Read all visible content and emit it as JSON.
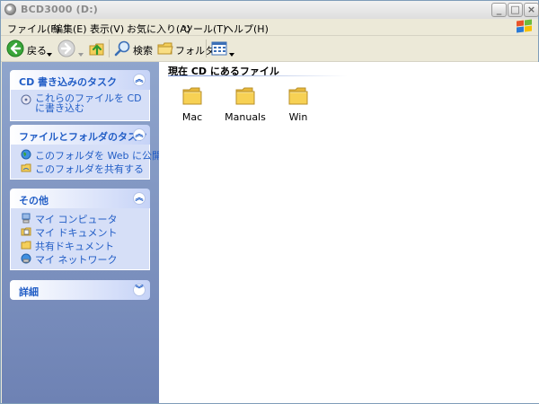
{
  "window": {
    "title": "BCD3000 (D:)",
    "minimize_glyph": "_",
    "maximize_glyph": "□",
    "close_glyph": "×"
  },
  "menu": [
    "ファイル(F)",
    "編集(E)",
    "表示(V)",
    "お気に入り(A)",
    "ツール(T)",
    "ヘルプ(H)"
  ],
  "toolbar": {
    "back_label": "戻る",
    "search_label": "検索",
    "folders_label": "フォルダ"
  },
  "left_pane": {
    "cd_tasks": {
      "title": "CD 書き込みのタスク",
      "items": [
        {
          "label": "これらのファイルを CD に書き込む",
          "icon": "cd-burn-icon"
        }
      ]
    },
    "folder_tasks": {
      "title": "ファイルとフォルダのタスク",
      "items": [
        {
          "label": "このフォルダを Web に公開する",
          "icon": "globe-icon"
        },
        {
          "label": "このフォルダを共有する",
          "icon": "share-folder-icon"
        }
      ]
    },
    "other": {
      "title": "その他",
      "items": [
        {
          "label": "マイ コンピュータ",
          "icon": "my-computer-icon"
        },
        {
          "label": "マイ ドキュメント",
          "icon": "my-documents-icon"
        },
        {
          "label": "共有ドキュメント",
          "icon": "shared-documents-icon"
        },
        {
          "label": "マイ ネットワーク",
          "icon": "my-network-icon"
        }
      ]
    },
    "details": {
      "title": "詳細"
    }
  },
  "main": {
    "heading": "現在 CD にあるファイル",
    "folders": [
      "Mac",
      "Manuals",
      "Win"
    ]
  },
  "colors": {
    "accent": "#215dc6",
    "pane_top": "#8fa5cc",
    "pane_bottom": "#6e82b4",
    "folder_yellow": "#f7d154"
  }
}
